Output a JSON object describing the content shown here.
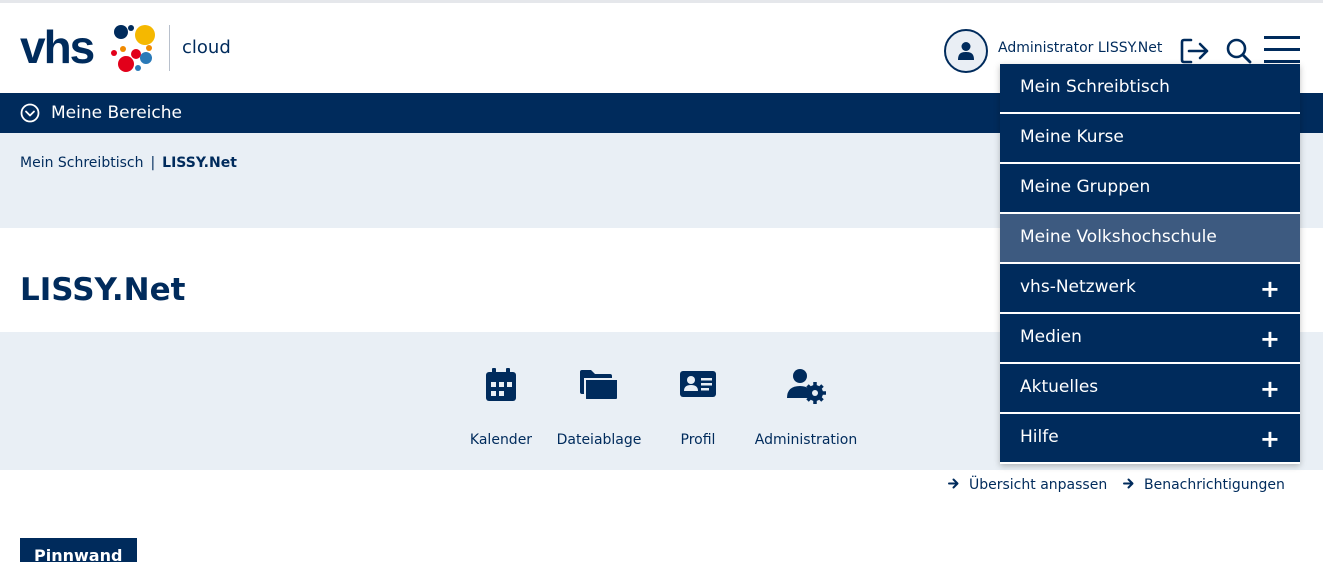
{
  "header": {
    "logo_text": "vhs",
    "logo_sub": "cloud",
    "user_name": "Administrator LISSY.Net",
    "icons": {
      "avatar": "user-avatar-icon",
      "logout": "logout-icon",
      "search": "search-icon",
      "menu": "hamburger-menu-icon"
    }
  },
  "bereiche_bar": {
    "label": "Meine Bereiche",
    "icon": "chevron-circle-down-icon"
  },
  "breadcrumb": {
    "items": [
      "Mein Schreibtisch",
      "LISSY.Net"
    ],
    "separator": "|"
  },
  "page_title": "LISSY.Net",
  "quick_links": [
    {
      "label": "Kalender",
      "icon": "calendar-icon"
    },
    {
      "label": "Dateiablage",
      "icon": "folder-icon"
    },
    {
      "label": "Profil",
      "icon": "id-card-icon"
    },
    {
      "label": "Administration",
      "icon": "user-gear-icon"
    }
  ],
  "actions": [
    {
      "label": "Übersicht anpassen",
      "icon": "arrow-right-icon"
    },
    {
      "label": "Benachrichtigungen",
      "icon": "arrow-right-icon"
    }
  ],
  "pinnwand_label": "Pinnwand",
  "menu": {
    "items": [
      {
        "label": "Mein Schreibtisch",
        "expandable": false,
        "active": false
      },
      {
        "label": "Meine Kurse",
        "expandable": false,
        "active": false
      },
      {
        "label": "Meine Gruppen",
        "expandable": false,
        "active": false
      },
      {
        "label": "Meine Volkshochschule",
        "expandable": false,
        "active": true
      },
      {
        "label": "vhs-Netzwerk",
        "expandable": true,
        "active": false
      },
      {
        "label": "Medien",
        "expandable": true,
        "active": false
      },
      {
        "label": "Aktuelles",
        "expandable": true,
        "active": false
      },
      {
        "label": "Hilfe",
        "expandable": true,
        "active": false
      }
    ],
    "expand_symbol": "+"
  },
  "colors": {
    "primary": "#002b5c",
    "band": "#e9eff5",
    "active": "#3d5a80",
    "logo_yellow": "#f5b800",
    "logo_red": "#e2001a",
    "logo_orange": "#f08a00",
    "logo_blue": "#2a7ab8"
  }
}
